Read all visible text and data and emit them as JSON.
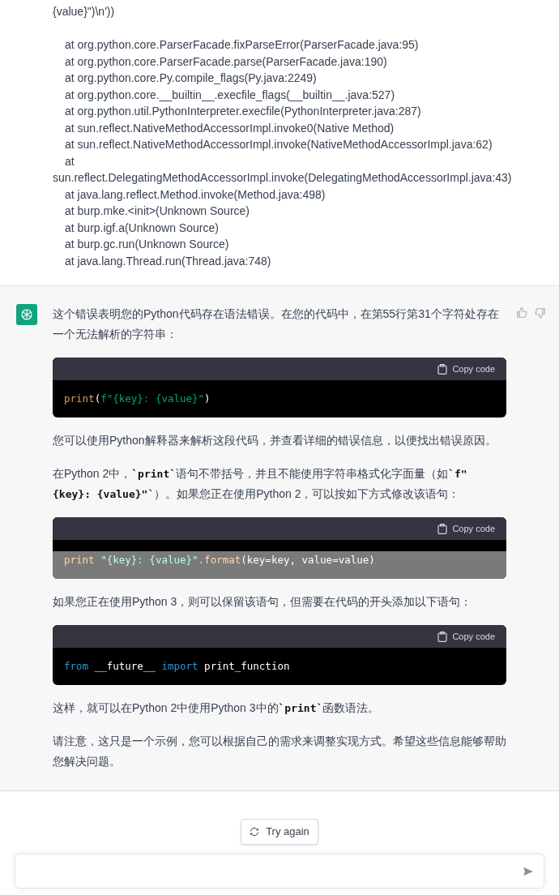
{
  "user_message": {
    "lines": [
      "{value}\")\\n'))"
    ],
    "trace": [
      "at org.python.core.ParserFacade.fixParseError(ParserFacade.java:95)",
      "at org.python.core.ParserFacade.parse(ParserFacade.java:190)",
      "at org.python.core.Py.compile_flags(Py.java:2249)",
      "at org.python.core.__builtin__.execfile_flags(__builtin__.java:527)",
      "at org.python.util.PythonInterpreter.execfile(PythonInterpreter.java:287)",
      "at sun.reflect.NativeMethodAccessorImpl.invoke0(Native Method)",
      "at sun.reflect.NativeMethodAccessorImpl.invoke(NativeMethodAccessorImpl.java:62)",
      "at sun.reflect.DelegatingMethodAccessorImpl.invoke(DelegatingMethodAccessorImpl.java:43)",
      "at java.lang.reflect.Method.invoke(Method.java:498)",
      "at burp.mke.<init>(Unknown Source)",
      "at burp.igf.a(Unknown Source)",
      "at burp.gc.run(Unknown Source)",
      "at java.lang.Thread.run(Thread.java:748)"
    ]
  },
  "assistant_message": {
    "blocks": [
      {
        "kind": "paragraph",
        "segments": [
          {
            "kind": "text",
            "text": "这个错误表明您的Python代码存在语法错误。在您的代码中，在第55行第31个字符处存在一个无法解析的字符串："
          }
        ]
      },
      {
        "kind": "code",
        "copy_label": "Copy code",
        "selected": false,
        "tokens": [
          {
            "kind": "func",
            "text": "print"
          },
          {
            "kind": "plain",
            "text": "("
          },
          {
            "kind": "string",
            "text": "f\"{key}: {value}\""
          },
          {
            "kind": "plain",
            "text": ")"
          }
        ]
      },
      {
        "kind": "paragraph",
        "segments": [
          {
            "kind": "text",
            "text": "您可以使用Python解释器来解析这段代码，并查看详细的错误信息，以便找出错误原因。"
          }
        ]
      },
      {
        "kind": "paragraph",
        "segments": [
          {
            "kind": "text",
            "text": "在Python 2中，"
          },
          {
            "kind": "code",
            "text": "`print`"
          },
          {
            "kind": "text",
            "text": "语句不带括号，并且不能使用字符串格式化字面量（如"
          },
          {
            "kind": "code",
            "text": "`f\" {key}: {value}\"`"
          },
          {
            "kind": "text",
            "text": "）。如果您正在使用Python 2，可以按如下方式修改该语句："
          }
        ]
      },
      {
        "kind": "code",
        "copy_label": "Copy code",
        "selected": true,
        "tokens": [
          {
            "kind": "func",
            "text": "print"
          },
          {
            "kind": "string",
            "text": " \"{key}: {value}\""
          },
          {
            "kind": "func",
            "text": ".format"
          },
          {
            "kind": "plain",
            "text": "(key=key, value=value)"
          }
        ]
      },
      {
        "kind": "paragraph",
        "segments": [
          {
            "kind": "text",
            "text": "如果您正在使用Python 3，则可以保留该语句，但需要在代码的开头添加以下语句："
          }
        ]
      },
      {
        "kind": "code",
        "copy_label": "Copy code",
        "selected": false,
        "tokens": [
          {
            "kind": "keyword",
            "text": "from"
          },
          {
            "kind": "plain",
            "text": " __future__ "
          },
          {
            "kind": "keyword",
            "text": "import"
          },
          {
            "kind": "plain",
            "text": " print_function"
          }
        ]
      },
      {
        "kind": "paragraph",
        "segments": [
          {
            "kind": "text",
            "text": "这样，就可以在Python 2中使用Python 3中的"
          },
          {
            "kind": "code",
            "text": "`print`"
          },
          {
            "kind": "text",
            "text": "函数语法。"
          }
        ]
      },
      {
        "kind": "paragraph",
        "segments": [
          {
            "kind": "text",
            "text": "请注意，这只是一个示例，您可以根据自己的需求来调整实现方式。希望这些信息能够帮助您解决问题。"
          }
        ]
      }
    ]
  },
  "try_again": {
    "label": "Try again"
  }
}
